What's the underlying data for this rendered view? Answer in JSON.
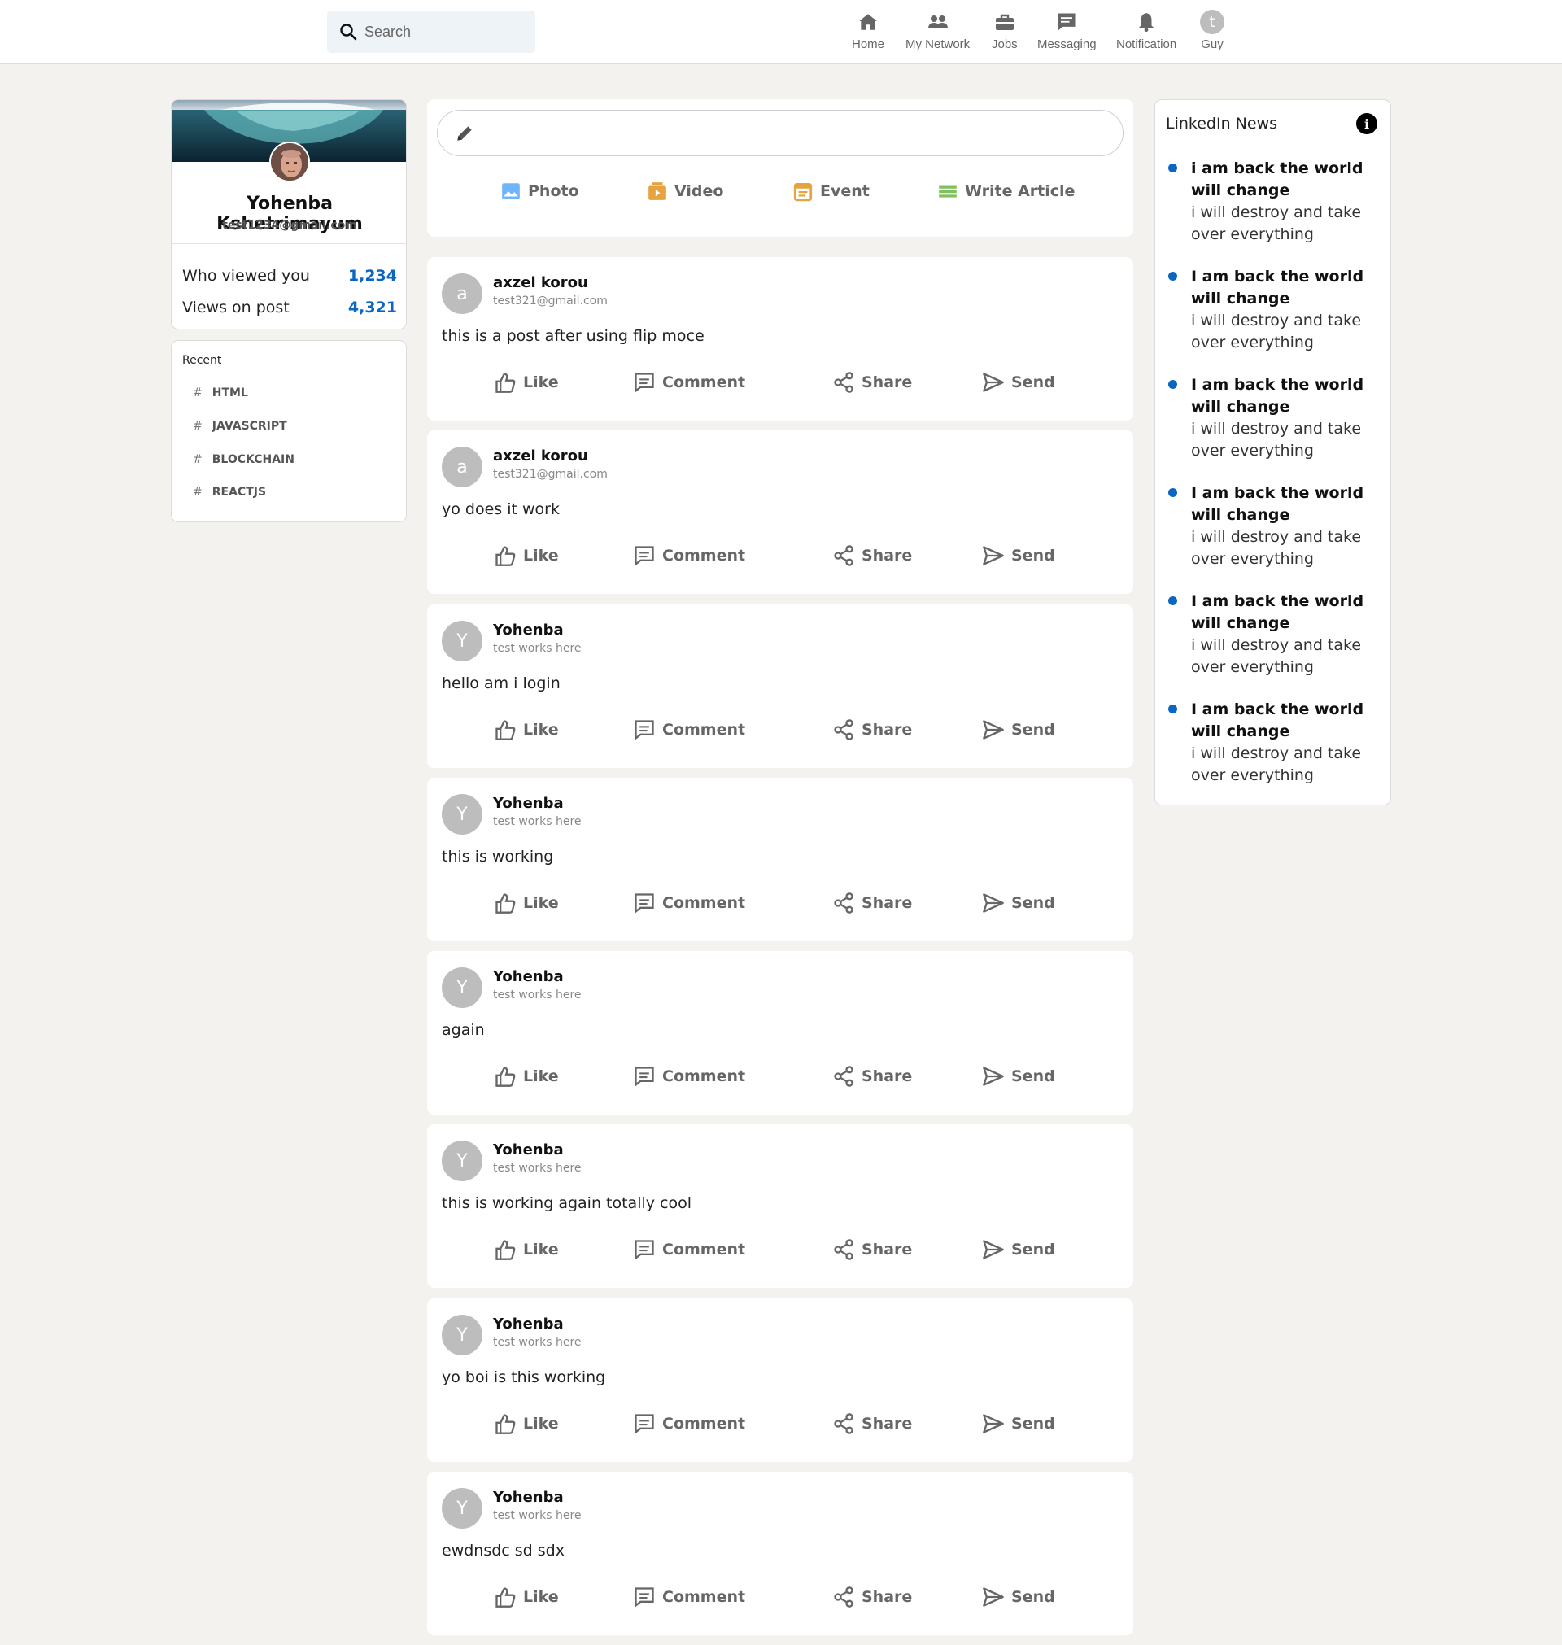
{
  "header": {
    "search": {
      "placeholder": "Search"
    },
    "nav": [
      {
        "label": "Home",
        "icon": "home-icon"
      },
      {
        "label": "My Network",
        "icon": "people-icon"
      },
      {
        "label": "Jobs",
        "icon": "briefcase-icon"
      },
      {
        "label": "Messaging",
        "icon": "message-icon"
      },
      {
        "label": "Notification",
        "icon": "bell-icon"
      },
      {
        "label": "Guy",
        "icon": "avatar",
        "initial": "t"
      }
    ]
  },
  "profile": {
    "name": "Yohenba Kshetrimayum",
    "email": "test1234@gmail.com",
    "stats": [
      {
        "label": "Who viewed you",
        "value": "1,234"
      },
      {
        "label": "Views on post",
        "value": "4,321"
      }
    ]
  },
  "recent": {
    "title": "Recent",
    "items": [
      "HTML",
      "JAVASCRIPT",
      "BLOCKCHAIN",
      "REACTJS"
    ],
    "hash": "#"
  },
  "share_box": {
    "actions": [
      {
        "label": "Photo",
        "icon": "photo-icon",
        "color": "#70b5f9"
      },
      {
        "label": "Video",
        "icon": "video-icon",
        "color": "#e7a33e"
      },
      {
        "label": "Event",
        "icon": "event-icon",
        "color": "#e7a33e"
      },
      {
        "label": "Write Article",
        "icon": "article-icon",
        "color": "#7fc15e"
      }
    ]
  },
  "post_actions": [
    "Like",
    "Comment",
    "Share",
    "Send"
  ],
  "posts": [
    {
      "initial": "a",
      "author": "axzel korou",
      "sub": "test321@gmail.com",
      "text": "this is a post after using flip moce"
    },
    {
      "initial": "a",
      "author": "axzel korou",
      "sub": "test321@gmail.com",
      "text": "yo does it work"
    },
    {
      "initial": "Y",
      "author": "Yohenba",
      "sub": "test works here",
      "text": "hello am i login"
    },
    {
      "initial": "Y",
      "author": "Yohenba",
      "sub": "test works here",
      "text": "this is working"
    },
    {
      "initial": "Y",
      "author": "Yohenba",
      "sub": "test works here",
      "text": "again"
    },
    {
      "initial": "Y",
      "author": "Yohenba",
      "sub": "test works here",
      "text": "this is working again totally cool"
    },
    {
      "initial": "Y",
      "author": "Yohenba",
      "sub": "test works here",
      "text": "yo boi is this working"
    },
    {
      "initial": "Y",
      "author": "Yohenba",
      "sub": "test works here",
      "text": "ewdnsdc sd sdx"
    }
  ],
  "news": {
    "title": "LinkedIn News",
    "info": "i",
    "items": [
      {
        "head": "i am back the world will change",
        "body": "i will destroy and take over everything"
      },
      {
        "head": "I am back the world will change",
        "body": "i will destroy and take over everything"
      },
      {
        "head": "I am back the world will change",
        "body": "i will destroy and take over everything"
      },
      {
        "head": "I am back the world will change",
        "body": "i will destroy and take over everything"
      },
      {
        "head": "I am back the world will change",
        "body": "i will destroy and take over everything"
      },
      {
        "head": "I am back the world will change",
        "body": "i will destroy and take over everything"
      }
    ]
  },
  "colors": {
    "accent": "#0a66c2",
    "background": "#f3f2ef"
  }
}
